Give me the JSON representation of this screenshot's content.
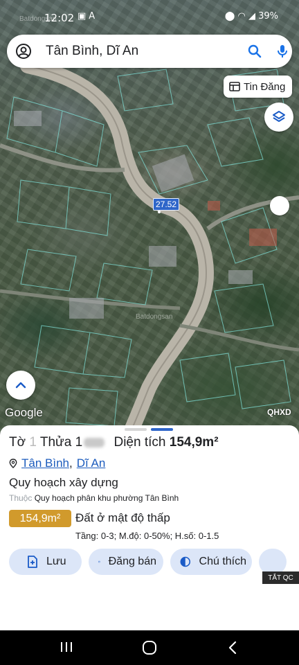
{
  "status_bar": {
    "time": "12:02",
    "battery": "39%",
    "left_icons": [
      "gallery-icon",
      "notification-icon"
    ],
    "right_icons": [
      "location-icon",
      "wifi-icon",
      "signal-icon"
    ]
  },
  "search": {
    "query": "Tân Bình, Dĩ An",
    "icons": [
      "account-icon",
      "search-icon",
      "mic-icon"
    ]
  },
  "map": {
    "tin_dang_label": "Tin Đăng",
    "marker_label": "27.52",
    "attribution": "Google",
    "layer_code": "QHXD",
    "watermark": "Batdongsan",
    "accent_color": "#2f66c9"
  },
  "sheet": {
    "title_prefix": "Tờ",
    "title_sheet_no_hidden": "1",
    "title_plot_label": "Thửa",
    "title_plot_no_hidden": "1",
    "title_area_label": "Diện tích",
    "title_area_value": "154,9m²",
    "location": {
      "ward": "Tân Bình",
      "separator": ",",
      "city": "Dĩ An"
    },
    "plan_heading": "Quy hoạch xây dựng",
    "plan_of_label": "Thuộc",
    "plan_name": "Quy hoạch phân khu phường Tân Bình",
    "badge_value": "154,9m²",
    "badge_color": "#d19a2c",
    "land_type": "Đất ở mật độ thấp",
    "spec": "Tầng: 0-3; M.độ: 0-50%; H.số: 0-1.5",
    "actions": [
      {
        "label": "Lưu",
        "icon": "bookmark-add-icon"
      },
      {
        "label": "Đăng bán",
        "icon": "listing-icon"
      },
      {
        "label": "Chú thích",
        "icon": "contrast-icon"
      },
      {
        "label": "",
        "icon": "camera-add-icon"
      }
    ],
    "ad_label": "TẮT QC"
  },
  "navbar": {
    "icons": [
      "recents-icon",
      "home-icon",
      "back-icon"
    ]
  }
}
